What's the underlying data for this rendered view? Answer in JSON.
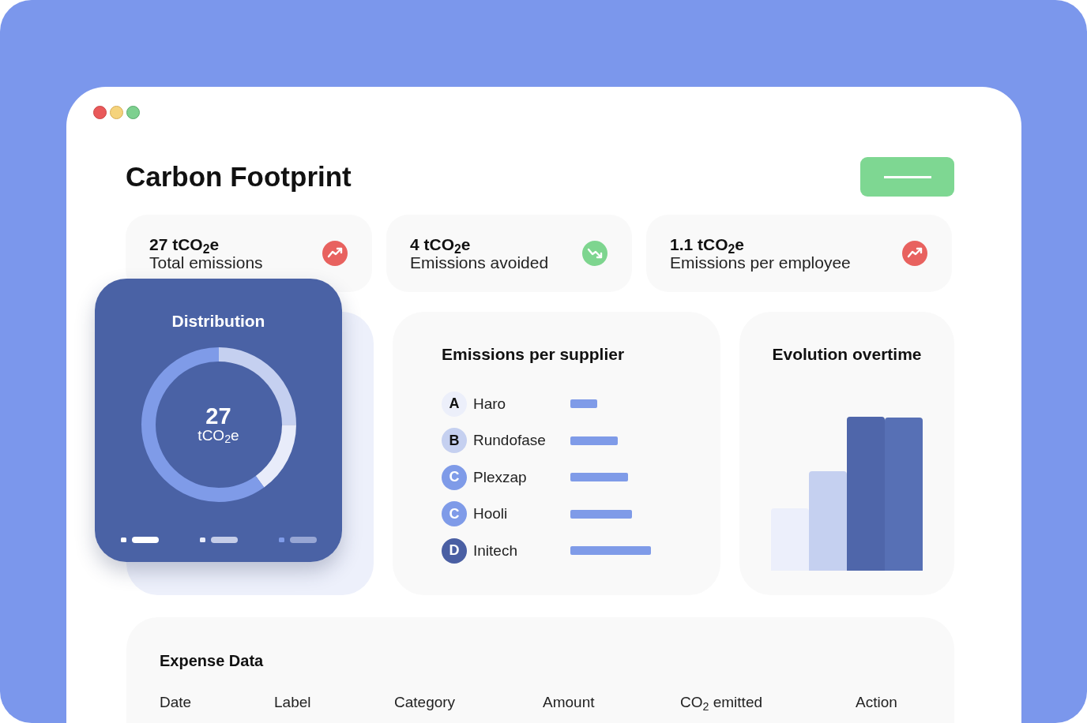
{
  "window": {
    "title": "Carbon Footprint",
    "controls": [
      {
        "kind": "close"
      },
      {
        "kind": "minimize"
      },
      {
        "kind": "zoom"
      }
    ]
  },
  "stats": [
    {
      "value": "27 tCO$_{2}$e",
      "label": "Total emissions",
      "kind": "rising"
    },
    {
      "value": "4 tCO$_{2}$e",
      "label": "Emissions avoided",
      "kind": "falling"
    },
    {
      "value": "1.1 tCO$_{2}$e",
      "label": "Emissions per employee",
      "kind": "rising"
    }
  ],
  "distribution": {
    "title": "Distribution",
    "total": "27",
    "unit": "tCO$_{2}$e"
  },
  "suppliers": {
    "title": "Emissions per supplier",
    "items": [
      {
        "grade": "A",
        "name": "Haro",
        "color": "#eceffa"
      },
      {
        "grade": "B",
        "name": "Rundofase",
        "color": "#c5d0f0"
      },
      {
        "grade": "C",
        "name": "Plexzap",
        "color": "#7f9be8"
      },
      {
        "grade": "C",
        "name": "Hooli",
        "color": "#7f9be8"
      },
      {
        "grade": "D",
        "name": "Initech",
        "color": "#4a5fa3"
      }
    ]
  },
  "evolution": {
    "title": "Evolution overtime"
  },
  "expenses": {
    "title": "Expense Data",
    "columns": [
      "Date",
      "Label",
      "Category",
      "Amount",
      "CO$_{2}$ emitted",
      "Action"
    ]
  }
}
